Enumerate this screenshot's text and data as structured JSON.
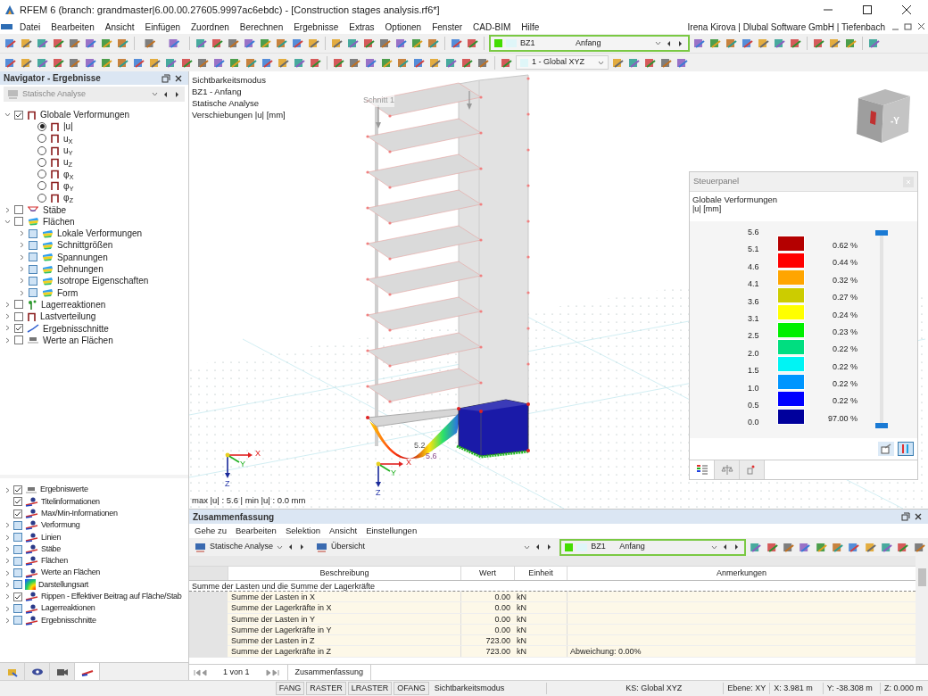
{
  "window": {
    "title": "RFEM 6 (branch: grandmaster|6.00.00.27605.9997ac6ebdc) - [Construction stages analysis.rf6*]"
  },
  "menu": [
    "Datei",
    "Bearbeiten",
    "Ansicht",
    "Einfügen",
    "Zuordnen",
    "Berechnen",
    "Ergebnisse",
    "Extras",
    "Optionen",
    "Fenster",
    "CAD-BIM",
    "Hilfe"
  ],
  "user_info": "Irena Kirova | Dlubal Software GmbH | Tiefenbach",
  "toolbar": {
    "load_case": {
      "code": "BZ1",
      "name": "Anfang",
      "color": "#44dd00"
    },
    "coordinate_system": "1 - Global XYZ"
  },
  "navigator": {
    "title": "Navigator - Ergebnisse",
    "analysis": "Statische Analyse",
    "items": [
      {
        "label": "Globale Verformungen",
        "checked": true,
        "partial": false,
        "expanded": true,
        "children": [
          {
            "kind": "radio",
            "label": "|u|",
            "selected": true
          },
          {
            "kind": "radio",
            "label": "u$_{X}$",
            "selected": false
          },
          {
            "kind": "radio",
            "label": "u$_{Y}$",
            "selected": false
          },
          {
            "kind": "radio",
            "label": "u$_{Z}$",
            "selected": false
          },
          {
            "kind": "radio",
            "label": "φ$_{X}$",
            "selected": false
          },
          {
            "kind": "radio",
            "label": "φ$_{Y}$",
            "selected": false
          },
          {
            "kind": "radio",
            "label": "φ$_{Z}$",
            "selected": false
          }
        ]
      },
      {
        "label": "Stäbe",
        "checked": false,
        "partial": false,
        "expanded": false
      },
      {
        "label": "Flächen",
        "checked": false,
        "partial": false,
        "expanded": true,
        "children": [
          {
            "label": "Lokale Verformungen",
            "checked": false,
            "partial": true,
            "expanded": false
          },
          {
            "label": "Schnittgrößen",
            "checked": false,
            "partial": true,
            "expanded": false
          },
          {
            "label": "Spannungen",
            "checked": false,
            "partial": true,
            "expanded": false
          },
          {
            "label": "Dehnungen",
            "checked": false,
            "partial": true,
            "expanded": false
          },
          {
            "label": "Isotrope Eigenschaften",
            "checked": false,
            "partial": true,
            "expanded": false
          },
          {
            "label": "Form",
            "checked": false,
            "partial": true,
            "expanded": false
          }
        ]
      },
      {
        "label": "Lagerreaktionen",
        "checked": false,
        "partial": false,
        "expanded": false
      },
      {
        "label": "Lastverteilung",
        "checked": false,
        "partial": false,
        "expanded": false
      },
      {
        "label": "Ergebnisschnitte",
        "checked": true,
        "partial": false,
        "expanded": false
      },
      {
        "label": "Werte an Flächen",
        "checked": false,
        "partial": false,
        "expanded": false
      }
    ],
    "display_items": [
      {
        "label": "Ergebniswerte",
        "checked": true,
        "partial": false,
        "expanded": false
      },
      {
        "label": "Titelinformationen",
        "checked": true,
        "partial": false
      },
      {
        "label": "Max/Min-Informationen",
        "checked": true,
        "partial": false
      },
      {
        "label": "Verformung",
        "checked": false,
        "partial": true,
        "expanded": false
      },
      {
        "label": "Linien",
        "checked": false,
        "partial": true,
        "expanded": false
      },
      {
        "label": "Stäbe",
        "checked": false,
        "partial": true,
        "expanded": false
      },
      {
        "label": "Flächen",
        "checked": false,
        "partial": true,
        "expanded": false
      },
      {
        "label": "Werte an Flächen",
        "checked": false,
        "partial": true,
        "expanded": false
      },
      {
        "label": "Darstellungsart",
        "checked": false,
        "partial": true,
        "expanded": false
      },
      {
        "label": "Rippen - Effektiver Beitrag auf Fläche/Stab",
        "checked": true,
        "partial": false,
        "expanded": false
      },
      {
        "label": "Lagerreaktionen",
        "checked": false,
        "partial": true,
        "expanded": false
      },
      {
        "label": "Ergebnisschnitte",
        "checked": false,
        "partial": true,
        "expanded": false
      }
    ],
    "tabs": [
      {
        "selected": false
      },
      {
        "selected": false
      },
      {
        "selected": false
      },
      {
        "selected": true
      }
    ]
  },
  "viewport": {
    "info_lines": [
      "Sichtbarkeitsmodus",
      "BZ1 - Anfang",
      "Statische Analyse",
      "Verschiebungen |u| [mm]"
    ],
    "section_label": "Schnitt 1",
    "value_labels": [
      "5.2",
      "5.6"
    ],
    "axis_triads": [
      [
        "X",
        "Y",
        "Z"
      ],
      [
        "X",
        "Y",
        "Z"
      ]
    ],
    "view_cube_label": "-Y",
    "max_min": "max |u| : 5.6 | min |u| : 0.0 mm"
  },
  "control_panel": {
    "title": "Steuerpanel",
    "heading": "Globale Verformungen",
    "unit": "|u| [mm]",
    "scale": [
      "5.6",
      "5.1",
      "4.6",
      "4.1",
      "3.6",
      "3.1",
      "2.5",
      "2.0",
      "1.5",
      "1.0",
      "0.5",
      "0.0"
    ],
    "bands": [
      {
        "color": "#b40000",
        "share": "0.62 %"
      },
      {
        "color": "#ff0000",
        "share": "0.44 %"
      },
      {
        "color": "#ffa500",
        "share": "0.32 %"
      },
      {
        "color": "#cccc00",
        "share": "0.27 %"
      },
      {
        "color": "#ffff00",
        "share": "0.24 %"
      },
      {
        "color": "#00f000",
        "share": "0.23 %"
      },
      {
        "color": "#00de80",
        "share": "0.22 %"
      },
      {
        "color": "#00f4f4",
        "share": "0.22 %"
      },
      {
        "color": "#0096ff",
        "share": "0.22 %"
      },
      {
        "color": "#0000ff",
        "share": "0.22 %"
      },
      {
        "color": "#00009c",
        "share": "97.00 %"
      }
    ],
    "slider_top": {
      "level": 1
    },
    "slider_bottom": {
      "level": 0
    },
    "tabs": [
      {
        "selected": true
      },
      {
        "selected": false
      },
      {
        "selected": false
      }
    ]
  },
  "summary": {
    "title": "Zusammenfassung",
    "menu": [
      "Gehe zu",
      "Bearbeiten",
      "Selektion",
      "Ansicht",
      "Einstellungen"
    ],
    "analysis": "Statische Analyse",
    "view": "Übersicht",
    "load_case": {
      "code": "BZ1",
      "name": "Anfang",
      "color": "#44dd00"
    },
    "columns": [
      "Beschreibung",
      "Wert",
      "Einheit",
      "Anmerkungen"
    ],
    "group": "Summe der Lasten und die Summe der Lagerkräfte",
    "rows": [
      {
        "description": "Summe der Lasten in X",
        "value": "0.00",
        "unit": "kN"
      },
      {
        "description": "Summe der Lagerkräfte in X",
        "value": "0.00",
        "unit": "kN"
      },
      {
        "description": "Summe der Lasten in Y",
        "value": "0.00",
        "unit": "kN"
      },
      {
        "description": "Summe der Lagerkräfte in Y",
        "value": "0.00",
        "unit": "kN"
      },
      {
        "description": "Summe der Lasten in Z",
        "value": "723.00",
        "unit": "kN"
      },
      {
        "description": "Summe der Lagerkräfte in Z",
        "value": "723.00",
        "unit": "kN",
        "note": "Abweichung: 0.00%"
      }
    ],
    "pager": "1 von 1",
    "sheets": [
      {
        "label": "Zusammenfassung",
        "selected": true
      }
    ]
  },
  "status_bar": {
    "toggles": [
      {
        "label": "FANG",
        "on": false
      },
      {
        "label": "RASTER",
        "on": false
      },
      {
        "label": "LRASTER",
        "on": false
      },
      {
        "label": "OFANG",
        "on": false
      }
    ],
    "mode": "Sichtbarkeitsmodus",
    "cs": "KS: Global XYZ",
    "plane": "Ebene: XY",
    "x": "X: 3.981 m",
    "y": "Y: -38.308 m",
    "z": "Z: 0.000 m"
  }
}
